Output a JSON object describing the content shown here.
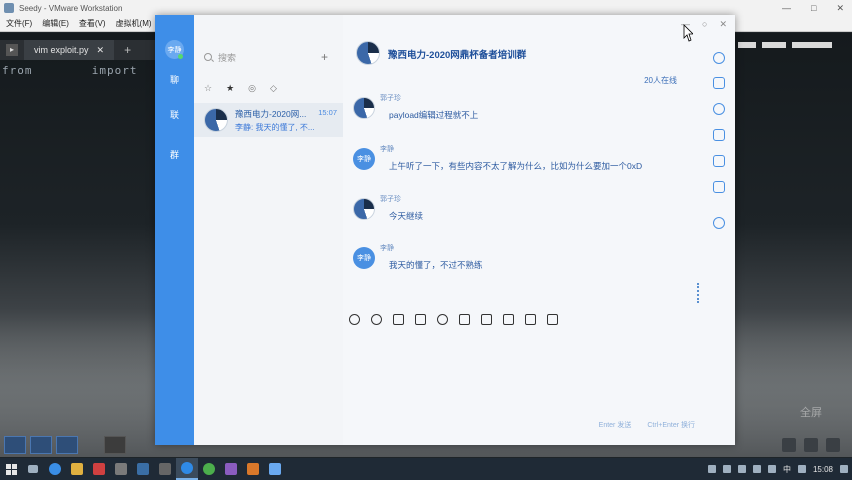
{
  "vmware": {
    "title": "Seedy - VMware Workstation",
    "menu": [
      "文件(F)",
      "编辑(E)",
      "查看(V)",
      "虚拟机(M)"
    ],
    "window_controls": [
      "—",
      "□",
      "✕"
    ],
    "terminal_tab": "vim exploit.py",
    "terminal_plus": "+",
    "code_from": "from",
    "code_import": "import",
    "watermark": "全屏"
  },
  "chat": {
    "search_placeholder": "搜索",
    "add_button": "+",
    "conv_tabs": [
      "☆",
      "★",
      "◎",
      "◇"
    ],
    "conversation": {
      "name": "豫西电力-2020网...",
      "time": "15:07",
      "preview": "李静: 我天的懂了, 不..."
    },
    "header_title": "豫西电力-2020网鼎杯备者培训群",
    "member_count": "20人在线",
    "window_controls": [
      "—",
      "○",
      "✕"
    ],
    "nav": {
      "avatar_label": "李静",
      "items": [
        "聊",
        "联",
        "群"
      ]
    },
    "messages": [
      {
        "avatar_type": "logo",
        "avatar_label": "",
        "name": "郭子珍",
        "text": "payload编辑过程就不上"
      },
      {
        "avatar_type": "text",
        "avatar_label": "李静",
        "name": "李静",
        "text": "上午听了一下，有些内容不太了解为什么，比如为什么要加一个0xD"
      },
      {
        "avatar_type": "logo",
        "avatar_label": "",
        "name": "郭子珍",
        "text": "今天继续"
      },
      {
        "avatar_type": "text",
        "avatar_label": "李静",
        "name": "李静",
        "text": "我天的懂了，不过不熟练"
      }
    ],
    "toolbar_icons": [
      "emoji-icon",
      "gif-icon",
      "like-icon",
      "scissors-icon",
      "at-icon",
      "image-icon",
      "file-icon",
      "screenshot-icon",
      "lightning-icon",
      "more-icon"
    ],
    "side_tools": [
      "chat-bubble-icon",
      "member-icon",
      "history-icon",
      "folder-icon",
      "share-icon",
      "app-icon",
      "settings-icon"
    ],
    "send_hints": [
      "Enter 发送",
      "Ctrl+Enter 换行"
    ]
  },
  "taskbar": {
    "tray": {
      "language": "中",
      "time": "15:08"
    }
  },
  "colors": {
    "nav_blue": "#3e8ee8",
    "text_blue": "#2c5aa0",
    "panel_bg": "#f3f5f8"
  }
}
